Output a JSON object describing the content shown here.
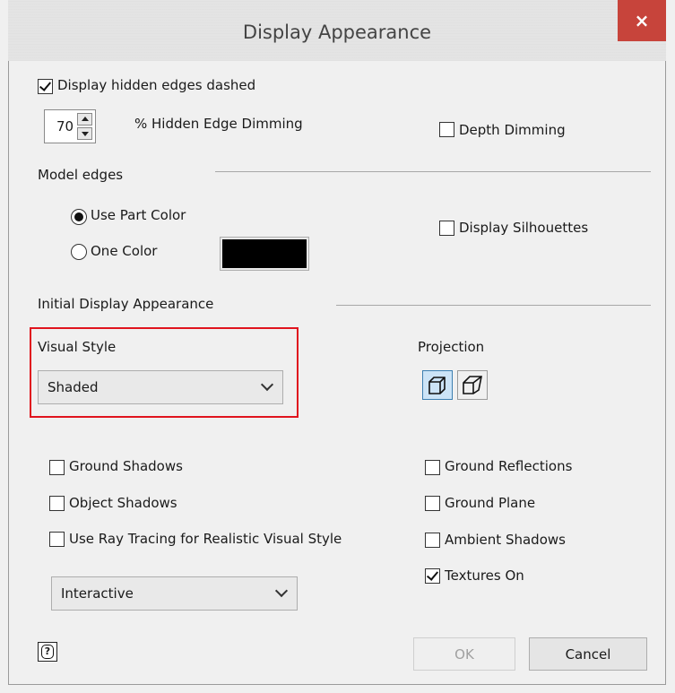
{
  "window": {
    "title": "Display Appearance",
    "close_glyph": "×"
  },
  "hidden_edges": {
    "label": "Display hidden edges dashed",
    "checked": true
  },
  "dimming": {
    "value": "70",
    "label": "% Hidden Edge Dimming"
  },
  "depth_dimming": {
    "label": "Depth Dimming",
    "checked": false
  },
  "model_edges": {
    "section_label": "Model edges",
    "use_part_color": {
      "label": "Use Part Color",
      "selected": true
    },
    "one_color": {
      "label": "One Color",
      "selected": false,
      "swatch_color": "#000000"
    }
  },
  "display_silhouettes": {
    "label": "Display Silhouettes",
    "checked": false
  },
  "initial_display": {
    "section_label": "Initial Display Appearance"
  },
  "visual_style": {
    "label": "Visual Style",
    "value": "Shaded",
    "highlight_color": "#e0141e"
  },
  "projection": {
    "label": "Projection",
    "buttons": [
      "orthographic-icon",
      "perspective-icon"
    ]
  },
  "checkboxes_left": [
    {
      "label": "Ground Shadows",
      "checked": false
    },
    {
      "label": "Object Shadows",
      "checked": false
    },
    {
      "label": "Use Ray Tracing for Realistic Visual Style",
      "checked": false
    }
  ],
  "checkboxes_right": [
    {
      "label": "Ground Reflections",
      "checked": false
    },
    {
      "label": "Ground Plane",
      "checked": false
    },
    {
      "label": "Ambient Shadows",
      "checked": false
    },
    {
      "label": "Textures On",
      "checked": true
    }
  ],
  "ray_mode": {
    "value": "Interactive"
  },
  "footer": {
    "help_icon": "help-icon",
    "ok_label": "OK",
    "cancel_label": "Cancel"
  },
  "colors": {
    "close_bg": "#c7443b",
    "accent": "#3c7fb1"
  }
}
